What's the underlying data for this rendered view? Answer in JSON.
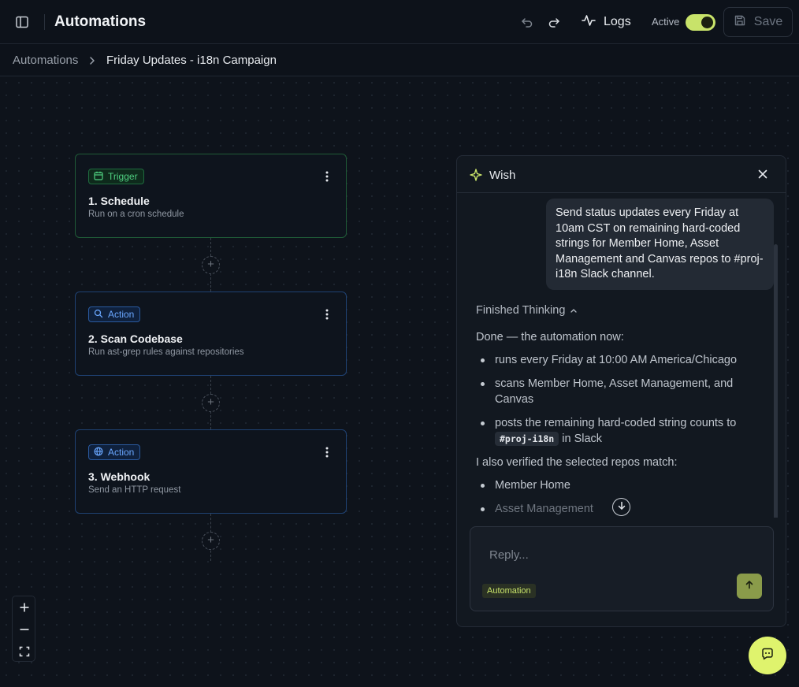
{
  "header": {
    "title": "Automations",
    "logs_label": "Logs",
    "active_label": "Active",
    "active_on": true,
    "save_label": "Save"
  },
  "breadcrumb": {
    "root": "Automations",
    "current": "Friday Updates - i18n Campaign"
  },
  "nodes": [
    {
      "badge": "Trigger",
      "badge_icon": "calendar-icon",
      "title": "1. Schedule",
      "subtitle": "Run on a cron schedule"
    },
    {
      "badge": "Action",
      "badge_icon": "search-icon",
      "title": "2. Scan Codebase",
      "subtitle": "Run ast-grep rules against repositories"
    },
    {
      "badge": "Action",
      "badge_icon": "globe-icon",
      "title": "3. Webhook",
      "subtitle": "Send an HTTP request"
    }
  ],
  "wish": {
    "title": "Wish",
    "user_message": "Send status updates every Friday at 10am CST on remaining hard-coded strings for Member Home, Asset Management and Canvas repos to #proj-i18n Slack channel.",
    "thinking_label": "Finished Thinking",
    "reply_intro": "Done — the automation now:",
    "reply_items": [
      "runs every Friday at 10:00 AM America/Chicago",
      "scans Member Home, Asset Management, and Canvas"
    ],
    "reply_item3_prefix": "posts the remaining hard-coded string counts to",
    "reply_item3_code": "#proj-i18n",
    "reply_item3_suffix": "in Slack",
    "verify_text": "I also verified the selected repos match:",
    "repos": [
      "Member Home",
      "Asset Management"
    ],
    "reply_placeholder": "Reply...",
    "context_chip": "Automation"
  },
  "colors": {
    "accent": "#dff36d",
    "trigger_border": "#1f5a37",
    "action_border": "#1f4273",
    "background": "#0d121a"
  }
}
